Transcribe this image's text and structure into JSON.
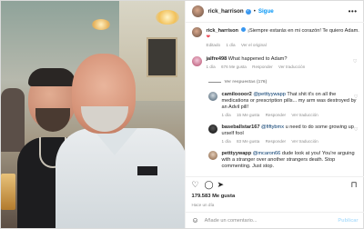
{
  "header": {
    "username": "rick_harrison",
    "follow_label": "Sigue",
    "more_icon": "more-horizontal-icon"
  },
  "caption": {
    "username": "rick_harrison",
    "text": "¡Siempre estarás en mi corazón! Te quiero Adam.",
    "heart": "❤",
    "meta": {
      "edited": "Editado",
      "age": "1 día",
      "see_translation": "Ver el original"
    }
  },
  "comments": [
    {
      "username": "jalfre498",
      "text": "What happened to Adam?",
      "meta": {
        "age": "1 día",
        "likes": "676 Me gusta",
        "reply": "Responder",
        "translate": "Ver traducción"
      },
      "view_replies": "Ver respuestas (176)"
    }
  ],
  "replies": [
    {
      "username": "camiloooor2",
      "mention": "@petttyywapp",
      "text": "That shit it's on all the medications or prescription pills... my arm was destroyed by an Advil pill!",
      "meta": {
        "age": "1 día",
        "likes": "15 Me gusta",
        "reply": "Responder",
        "translate": "Ver traducción"
      }
    },
    {
      "username": "baseballstar167",
      "mention": "@fiftybmx",
      "text": "u need to do some growing up urself fool",
      "meta": {
        "age": "1 día",
        "likes": "83 Me gusta",
        "reply": "Responder",
        "translate": "Ver traducción"
      }
    },
    {
      "username": "petttyywapp",
      "mention": "@mcaron66",
      "text": "dude look at you! You're arguing with a stranger over another strangers death. Stop commenting. Just stop.",
      "meta": {
        "age": "",
        "likes": "",
        "reply": "",
        "translate": ""
      }
    }
  ],
  "engagement": {
    "likes": "179.583 Me gusta",
    "time": "Hace un día"
  },
  "composer": {
    "placeholder": "Añade un comentario...",
    "publish_label": "Publicar"
  },
  "colors": {
    "accent": "#0095f6",
    "verified": "#3897f0",
    "muted": "#8e8e8e",
    "text": "#262626",
    "border": "#dbdbdb"
  }
}
